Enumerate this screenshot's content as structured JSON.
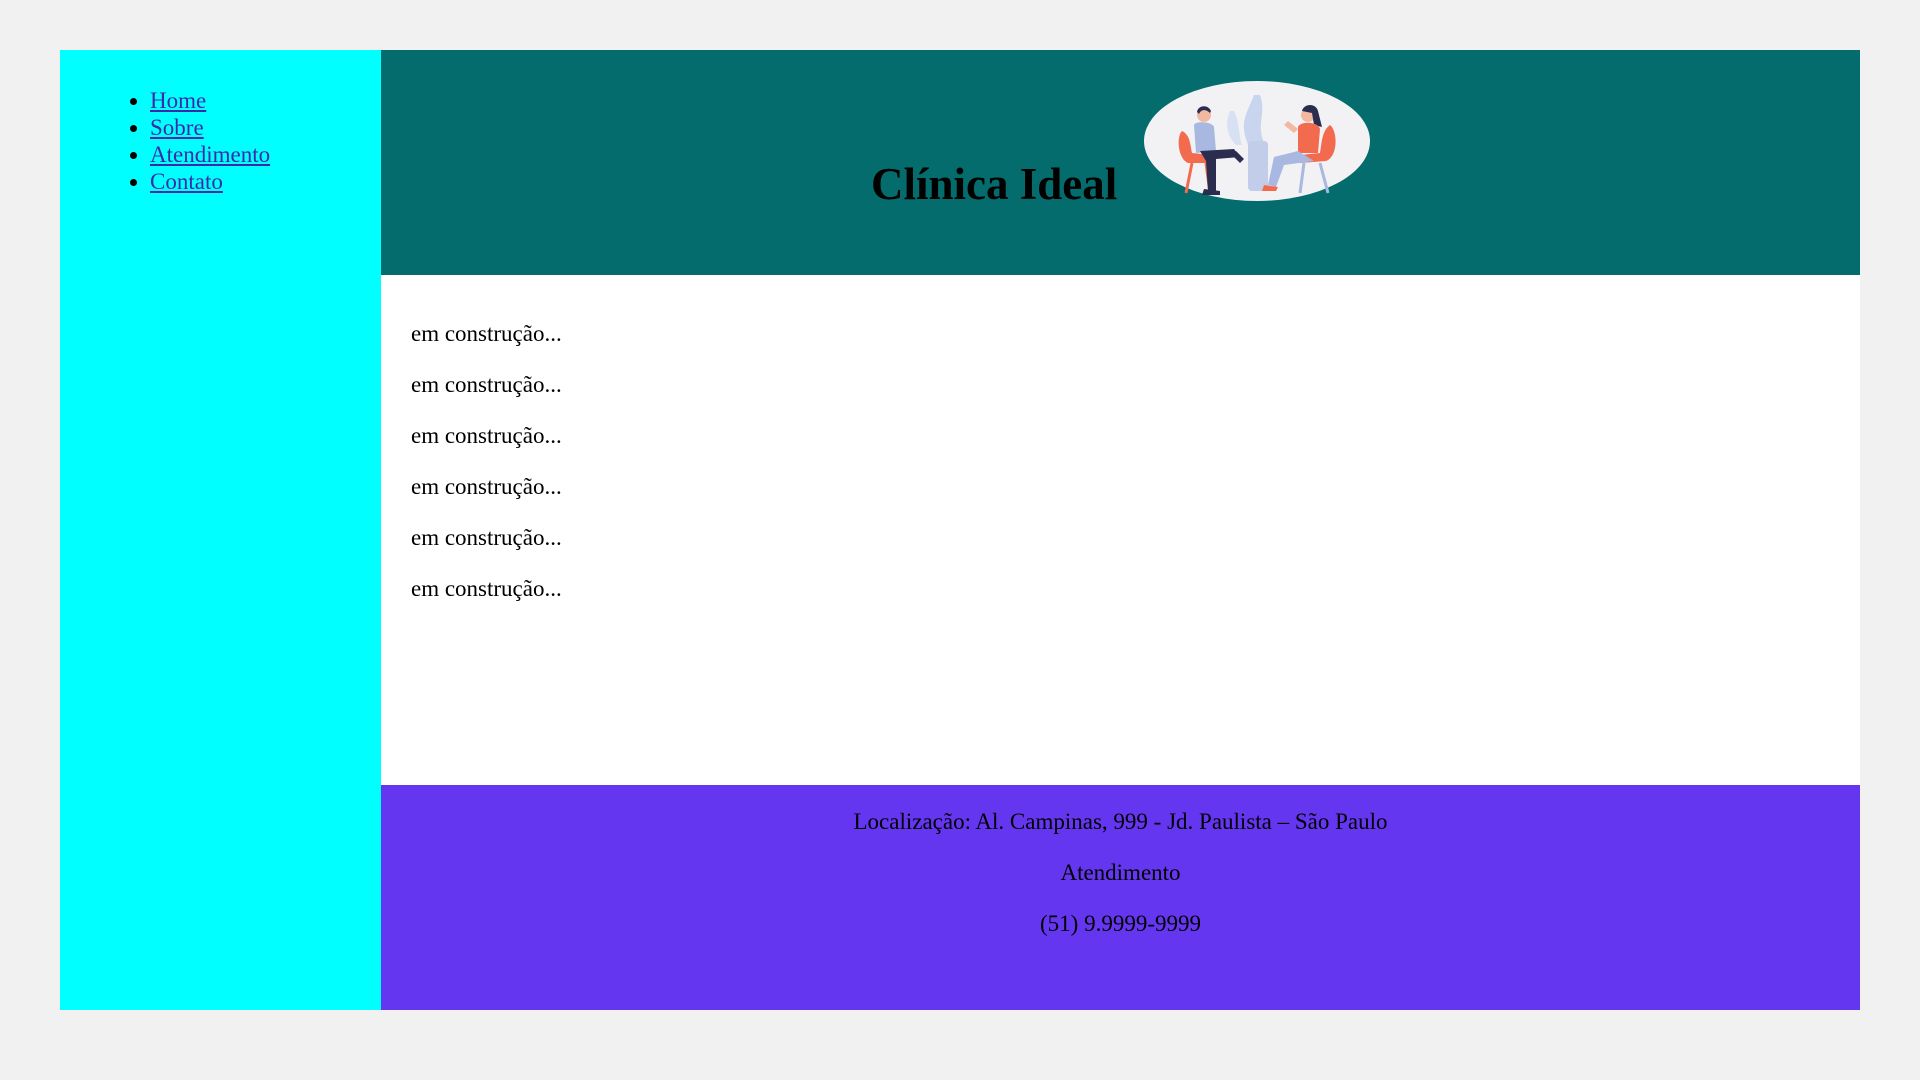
{
  "nav": {
    "items": [
      {
        "label": "Home"
      },
      {
        "label": "Sobre"
      },
      {
        "label": "Atendimento"
      },
      {
        "label": "Contato"
      }
    ]
  },
  "header": {
    "title": "Clínica Ideal",
    "logo_icon": "therapy-session-illustration"
  },
  "main": {
    "paragraphs": [
      "em construção...",
      "em construção...",
      "em construção...",
      "em construção...",
      "em construção...",
      "em construção..."
    ]
  },
  "footer": {
    "location": "Localização: Al. Campinas, 999 - Jd. Paulista – São Paulo",
    "service": "Atendimento",
    "phone": "(51) 9.9999-9999"
  },
  "colors": {
    "page_bg": "#f1f1f1",
    "sidebar_bg": "#00ffff",
    "header_bg": "#046c6c",
    "main_bg": "#ffffff",
    "footer_bg": "#6536ef",
    "link": "#3d2aa8"
  }
}
